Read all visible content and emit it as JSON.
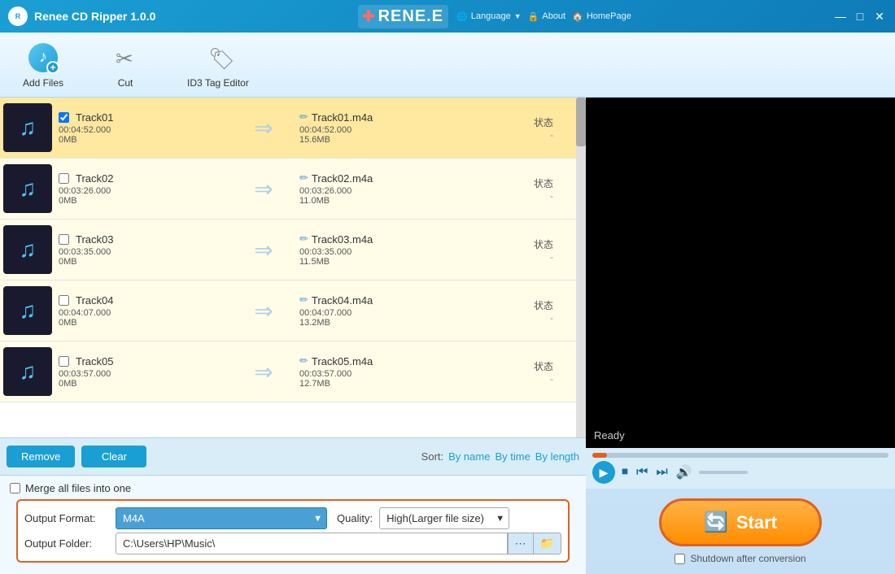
{
  "app": {
    "title": "Renee CD Ripper 1.0.0",
    "brand_name": "RENE.E",
    "language_label": "Language",
    "about_label": "About",
    "homepage_label": "HomePage"
  },
  "titlebar": {
    "minimize": "—",
    "maximize": "□",
    "close": "✕"
  },
  "toolbar": {
    "add_files_label": "Add Files",
    "cut_label": "Cut",
    "id3_tag_label": "ID3 Tag Editor"
  },
  "tracks": [
    {
      "name": "Track01",
      "duration": "00:04:52.000",
      "size_in": "0MB",
      "output_name": "Track01.m4a",
      "output_duration": "00:04:52.000",
      "output_size": "15.6MB",
      "status_label": "状态",
      "status_value": "-",
      "selected": true
    },
    {
      "name": "Track02",
      "duration": "00:03:26.000",
      "size_in": "0MB",
      "output_name": "Track02.m4a",
      "output_duration": "00:03:26.000",
      "output_size": "11.0MB",
      "status_label": "状态",
      "status_value": "-",
      "selected": false
    },
    {
      "name": "Track03",
      "duration": "00:03:35.000",
      "size_in": "0MB",
      "output_name": "Track03.m4a",
      "output_duration": "00:03:35.000",
      "output_size": "11.5MB",
      "status_label": "状态",
      "status_value": "-",
      "selected": false
    },
    {
      "name": "Track04",
      "duration": "00:04:07.000",
      "size_in": "0MB",
      "output_name": "Track04.m4a",
      "output_duration": "00:04:07.000",
      "output_size": "13.2MB",
      "status_label": "状态",
      "status_value": "-",
      "selected": false
    },
    {
      "name": "Track05",
      "duration": "00:03:57.000",
      "size_in": "0MB",
      "output_name": "Track05.m4a",
      "output_duration": "00:03:57.000",
      "output_size": "12.7MB",
      "status_label": "状态",
      "status_value": "-",
      "selected": false
    }
  ],
  "bottom_bar": {
    "remove_label": "Remove",
    "clear_label": "Clear",
    "sort_label": "Sort:",
    "sort_by_name": "By name",
    "sort_by_time": "By time",
    "sort_by_length": "By length"
  },
  "output": {
    "merge_label": "Merge all files into one",
    "format_label": "Output Format:",
    "format_value": "M4A",
    "quality_label": "Quality:",
    "quality_value": "High(Larger file size)",
    "folder_label": "Output Folder:",
    "folder_path": "C:\\Users\\HP\\Music\\"
  },
  "player": {
    "ready_label": "Ready"
  },
  "start": {
    "label": "Start",
    "shutdown_label": "Shutdown after conversion"
  }
}
